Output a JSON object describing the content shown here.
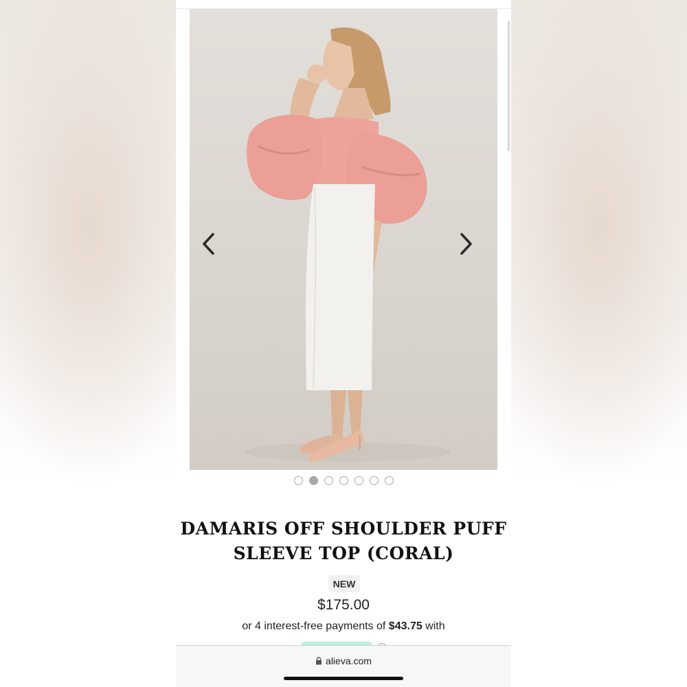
{
  "product": {
    "title_line1": "DAMARIS OFF SHOULDER PUFF",
    "title_line2": "SLEEVE TOP (CORAL)",
    "badge": "NEW",
    "price": "$175.00",
    "installments_prefix": "or 4 interest-free payments of ",
    "installments_amount": "$43.75",
    "installments_suffix": " with"
  },
  "gallery": {
    "total_images": 7,
    "active_index": 1,
    "prev_icon": "chevron-left-icon",
    "next_icon": "chevron-right-icon"
  },
  "browser": {
    "url": "alieva.com",
    "lock_icon": "lock-icon"
  },
  "colors": {
    "accent_mint": "#b2f5e1",
    "coral": "#eda39a",
    "dot_active": "#a8a8a8"
  }
}
